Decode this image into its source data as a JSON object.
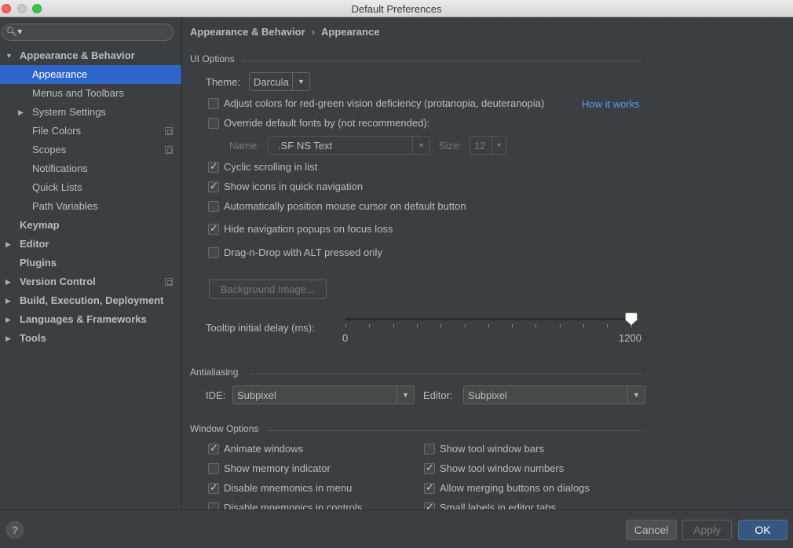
{
  "window": {
    "title": "Default Preferences"
  },
  "sidebar": {
    "search_placeholder": "",
    "items": [
      {
        "label": "Appearance & Behavior",
        "bold": true,
        "expanded": true
      },
      {
        "label": "Appearance",
        "selected": true
      },
      {
        "label": "Menus and Toolbars"
      },
      {
        "label": "System Settings",
        "expandable": true
      },
      {
        "label": "File Colors",
        "project_icon": true
      },
      {
        "label": "Scopes",
        "project_icon": true
      },
      {
        "label": "Notifications"
      },
      {
        "label": "Quick Lists"
      },
      {
        "label": "Path Variables"
      },
      {
        "label": "Keymap",
        "bold": true
      },
      {
        "label": "Editor",
        "bold": true,
        "expandable": true
      },
      {
        "label": "Plugins",
        "bold": true
      },
      {
        "label": "Version Control",
        "bold": true,
        "expandable": true,
        "project_icon": true
      },
      {
        "label": "Build, Execution, Deployment",
        "bold": true,
        "expandable": true
      },
      {
        "label": "Languages & Frameworks",
        "bold": true,
        "expandable": true
      },
      {
        "label": "Tools",
        "bold": true,
        "expandable": true
      }
    ]
  },
  "breadcrumb": {
    "parent": "Appearance & Behavior",
    "separator": "›",
    "current": "Appearance"
  },
  "ui_options": {
    "title": "UI Options",
    "theme_label": "Theme:",
    "theme_value": "Darcula",
    "adjust_colors": {
      "label": "Adjust colors for red-green vision deficiency (protanopia, deuteranopia)",
      "checked": false
    },
    "how_it_works": "How it works",
    "override_fonts": {
      "label": "Override default fonts by (not recommended):",
      "checked": false
    },
    "font_name_label": "Name:",
    "font_name_value": ".SF NS Text",
    "font_size_label": "Size:",
    "font_size_value": "12",
    "cyclic_scrolling": {
      "label": "Cyclic scrolling in list",
      "checked": true
    },
    "show_icons": {
      "label": "Show icons in quick navigation",
      "checked": true
    },
    "auto_position": {
      "label": "Automatically position mouse cursor on default button",
      "checked": false
    },
    "hide_popups": {
      "label": "Hide navigation popups on focus loss",
      "checked": true
    },
    "drag_drop": {
      "label": "Drag-n-Drop with ALT pressed only",
      "checked": false
    },
    "background_image": "Background Image...",
    "tooltip_label": "Tooltip initial delay (ms):",
    "tooltip_min": "0",
    "tooltip_max": "1200",
    "tooltip_value": 1200
  },
  "antialiasing": {
    "title": "Antialiasing",
    "ide_label": "IDE:",
    "ide_value": "Subpixel",
    "editor_label": "Editor:",
    "editor_value": "Subpixel"
  },
  "window_options": {
    "title": "Window Options",
    "animate_windows": {
      "label": "Animate windows",
      "checked": true
    },
    "show_memory": {
      "label": "Show memory indicator",
      "checked": false
    },
    "disable_mnemonics_menu": {
      "label": "Disable mnemonics in menu",
      "checked": true
    },
    "disable_mnemonics_controls": {
      "label": "Disable mnemonics in controls",
      "checked": false
    },
    "show_tool_window_bars": {
      "label": "Show tool window bars",
      "checked": false
    },
    "show_tool_window_numbers": {
      "label": "Show tool window numbers",
      "checked": true
    },
    "allow_merging": {
      "label": "Allow merging buttons on dialogs",
      "checked": true
    },
    "small_labels": {
      "label": "Small labels in editor tabs",
      "checked": true
    }
  },
  "footer": {
    "help": "?",
    "cancel": "Cancel",
    "apply": "Apply",
    "ok": "OK"
  }
}
